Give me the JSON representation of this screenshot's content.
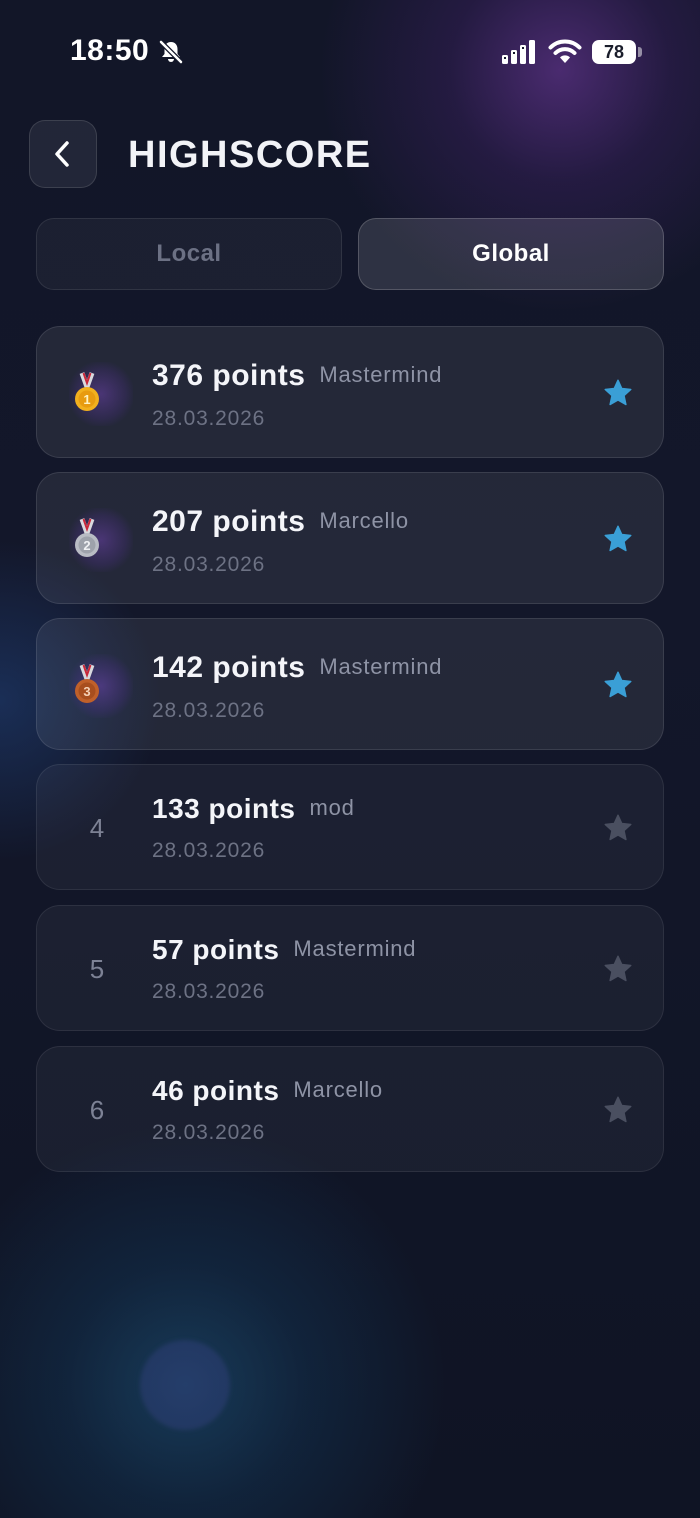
{
  "status_bar": {
    "time": "18:50",
    "battery_level": "78"
  },
  "header": {
    "title": "HIGHSCORE"
  },
  "tabs": [
    {
      "label": "Local",
      "active": false
    },
    {
      "label": "Global",
      "active": true
    }
  ],
  "colors": {
    "star_active": "#3a9fd6",
    "star_inactive": "#4a4f60",
    "gold": "#f2b01e",
    "silver": "#b9bcc4",
    "bronze": "#c0602a"
  },
  "scores": [
    {
      "rank": "1",
      "medal": "gold-medal-icon",
      "points": "376 points",
      "player": "Mastermind",
      "date": "28.03.2026",
      "starred": true
    },
    {
      "rank": "2",
      "medal": "silver-medal-icon",
      "points": "207 points",
      "player": "Marcello",
      "date": "28.03.2026",
      "starred": true
    },
    {
      "rank": "3",
      "medal": "bronze-medal-icon",
      "points": "142 points",
      "player": "Mastermind",
      "date": "28.03.2026",
      "starred": true
    },
    {
      "rank": "4",
      "medal": "",
      "points": "133 points",
      "player": "mod",
      "date": "28.03.2026",
      "starred": false
    },
    {
      "rank": "5",
      "medal": "",
      "points": "57 points",
      "player": "Mastermind",
      "date": "28.03.2026",
      "starred": false
    },
    {
      "rank": "6",
      "medal": "",
      "points": "46 points",
      "player": "Marcello",
      "date": "28.03.2026",
      "starred": false
    }
  ]
}
